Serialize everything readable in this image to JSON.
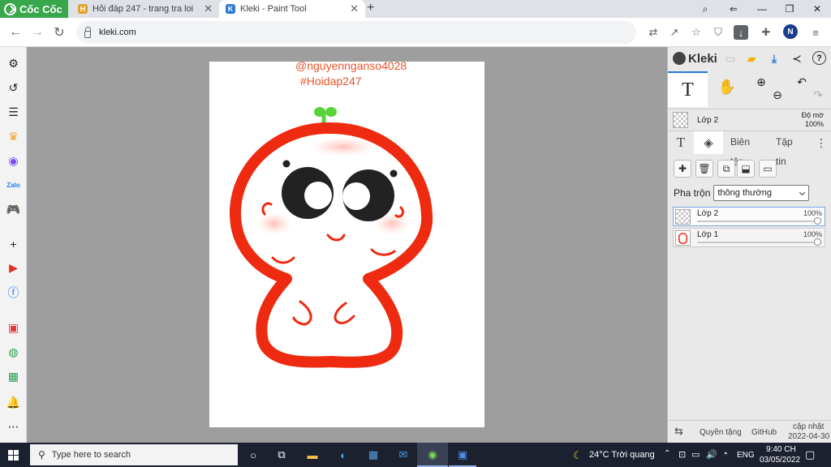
{
  "browser": {
    "brand": "Cốc Cốc",
    "tabs": [
      {
        "label": "Hỏi đáp 247 - trang tra loi",
        "favicon_color": "#e2a12b",
        "favicon_letter": "H"
      },
      {
        "label": "Kleki - Paint Tool",
        "favicon_color": "#2c78d1",
        "favicon_letter": "K"
      }
    ],
    "url": "kleki.com",
    "profile_initial": "N"
  },
  "canvas": {
    "watermark_line1": "@nguyennganso4028",
    "watermark_line2": "#Hoidap247",
    "accent_color": "#ee2a10",
    "sprout_color": "#58d33a"
  },
  "kleki": {
    "logo": "Kleki",
    "tool_text_glyph": "T",
    "current_layer": "Lớp 2",
    "opacity_label": "Độ mờ",
    "opacity_value": "100%",
    "tabs": [
      "Biên tập",
      "Tập tin"
    ],
    "blend_label": "Pha trộn",
    "blend_value": "thông thường",
    "layers": [
      {
        "name": "Lớp 2",
        "opacity": "100%",
        "selected": true
      },
      {
        "name": "Lớp 1",
        "opacity": "100%",
        "selected": false
      }
    ],
    "footer": {
      "privacy": "Quyền tặng",
      "github": "GitHub",
      "updated": "cập nhật",
      "updated_date": "2022-04-30"
    }
  },
  "taskbar": {
    "search_placeholder": "Type here to search",
    "weather": "24°C  Trời quang",
    "lang": "ENG",
    "time": "9:40 CH",
    "date": "03/05/2022"
  }
}
